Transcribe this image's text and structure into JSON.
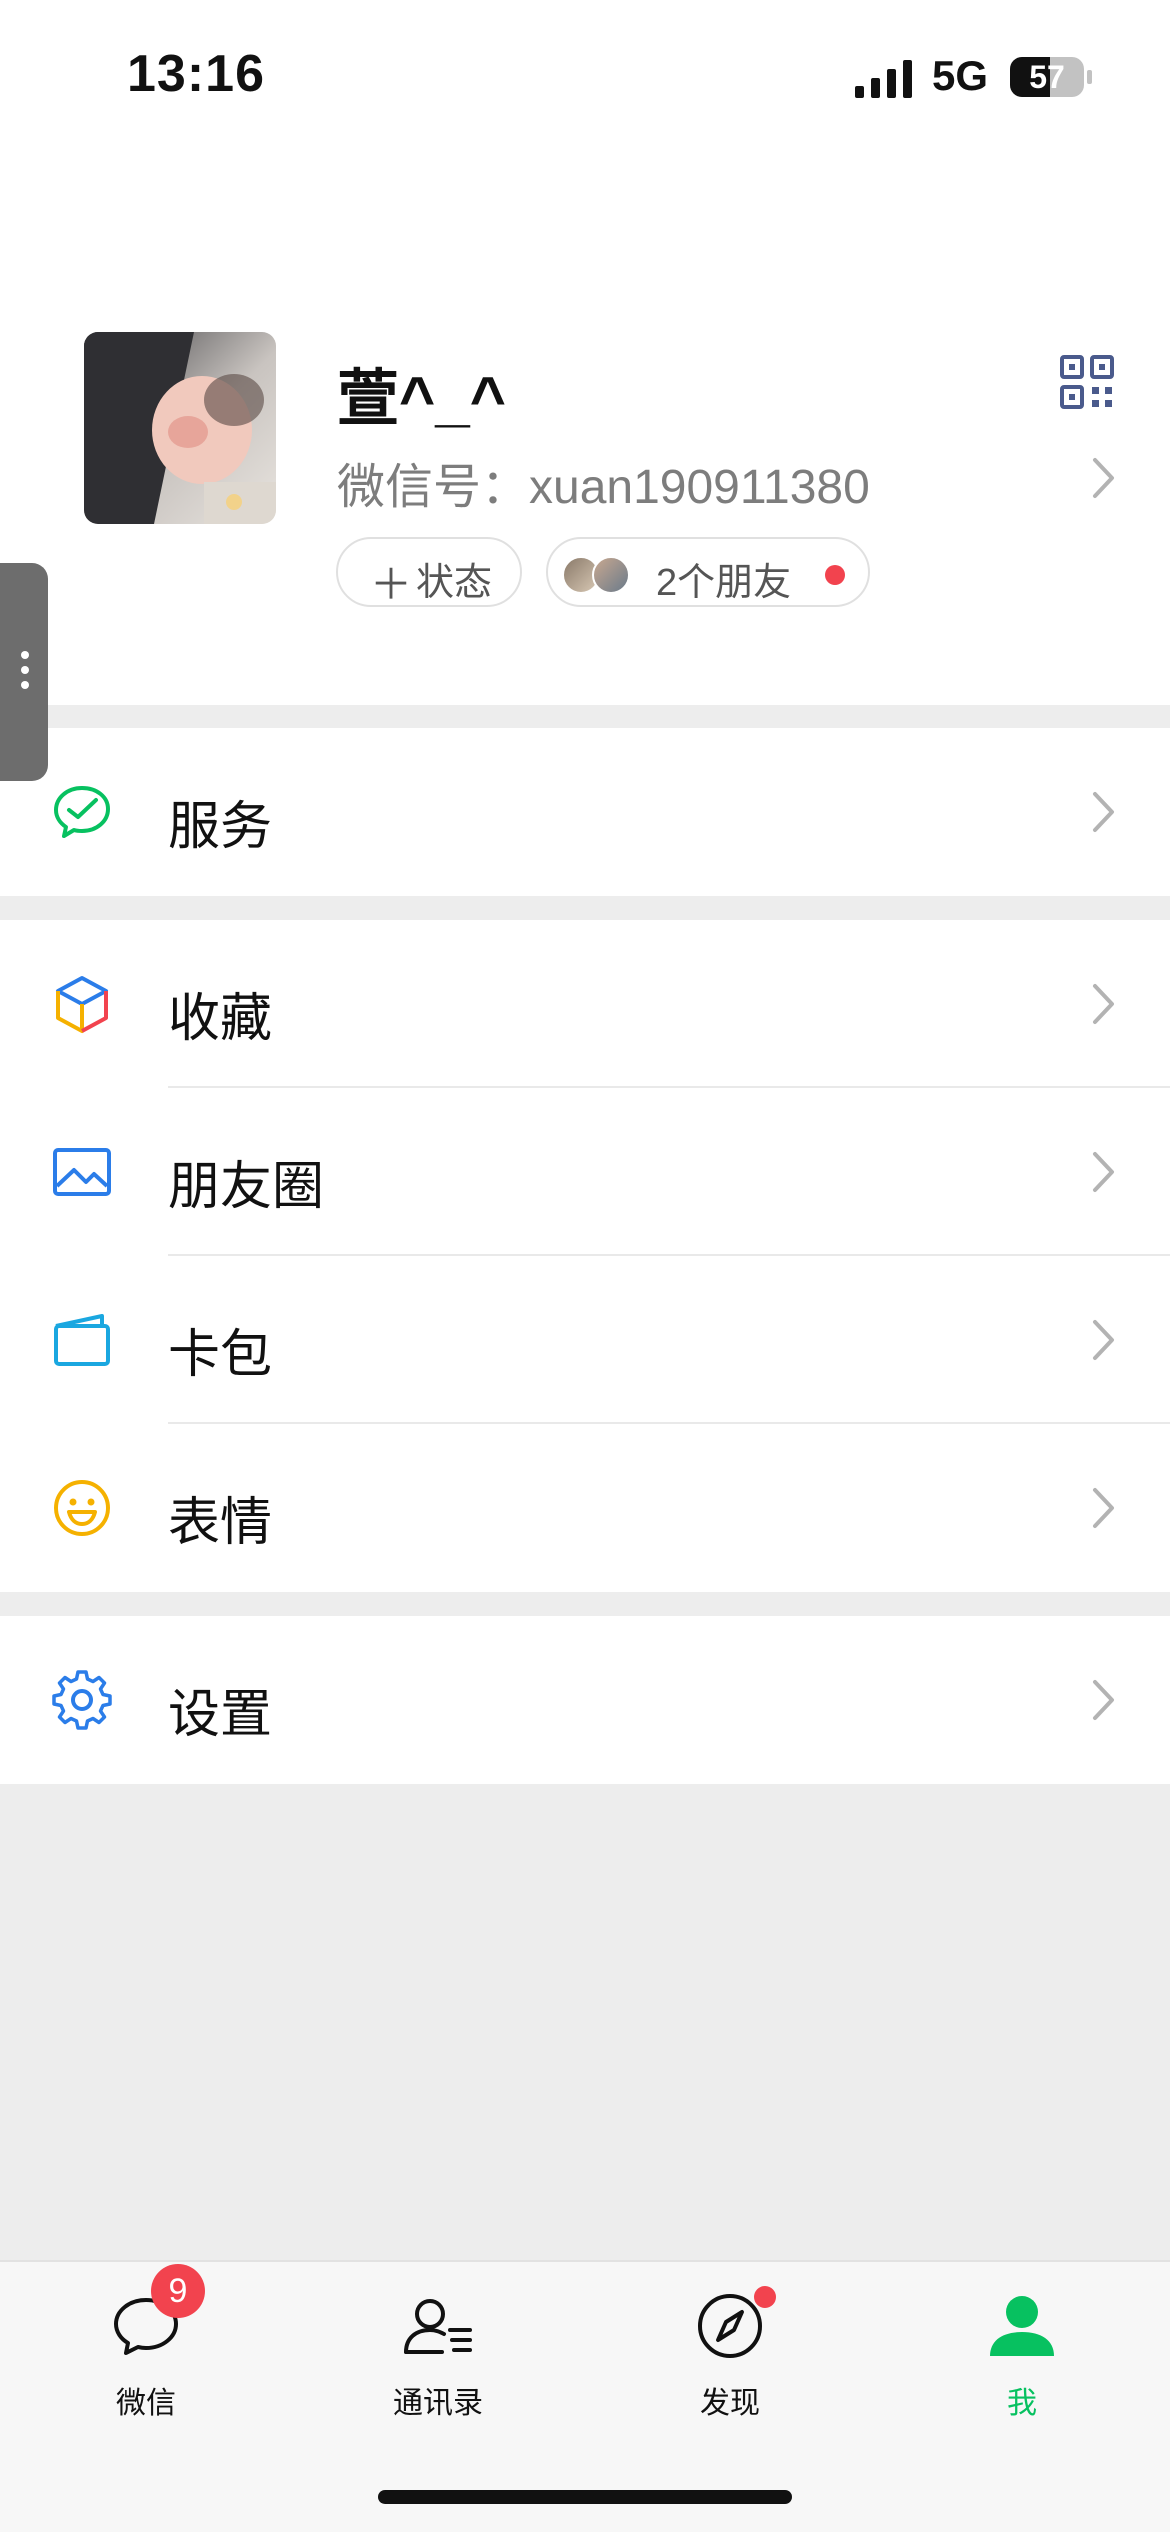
{
  "status_bar": {
    "time": "13:16",
    "network": "5G",
    "battery": "57"
  },
  "profile": {
    "nickname": "萱^_^",
    "wechat_id": "微信号：xuan190911380",
    "status_pill": {
      "plus": "＋",
      "label": "状态"
    },
    "friends_pill": {
      "label": "2个朋友"
    }
  },
  "menu": {
    "services": "服务",
    "favorites": "收藏",
    "moments": "朋友圈",
    "cards": "卡包",
    "stickers": "表情",
    "settings": "设置"
  },
  "tabbar": {
    "chats": {
      "label": "微信",
      "badge": "9"
    },
    "contacts": {
      "label": "通讯录"
    },
    "discover": {
      "label": "发现"
    },
    "me": {
      "label": "我"
    }
  },
  "colors": {
    "accent_green": "#07c160",
    "badge_red": "#f2434e",
    "icon_blue": "#1a73e8",
    "page_bg": "#ededed"
  }
}
